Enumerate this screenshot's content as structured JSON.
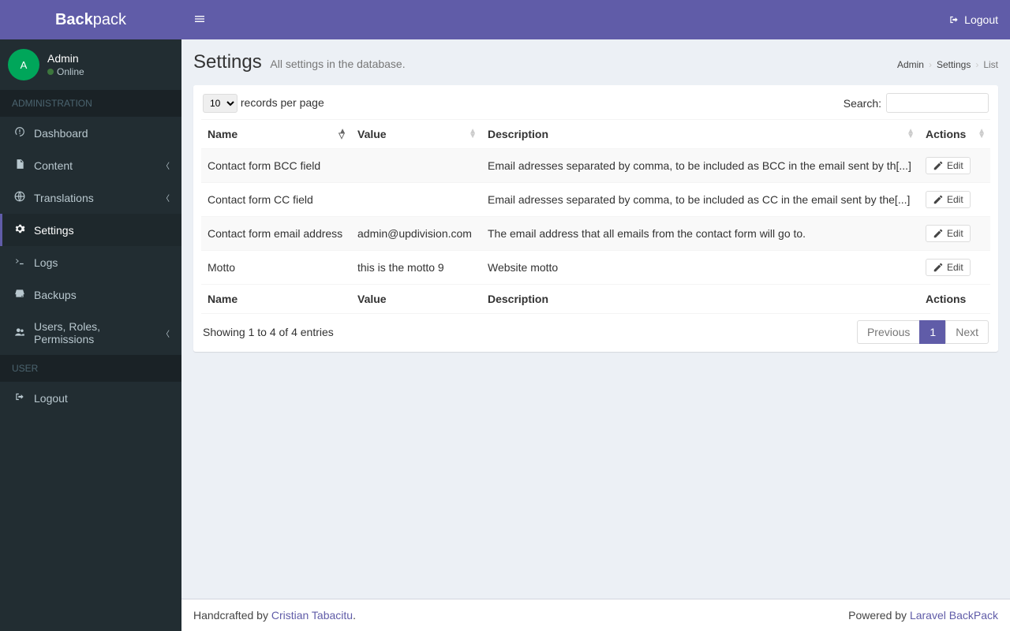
{
  "brand": {
    "bold": "Back",
    "light": "pack"
  },
  "user": {
    "name": "Admin",
    "status": "Online",
    "avatar_initial": "A"
  },
  "topbar": {
    "logout": "Logout"
  },
  "nav": {
    "section_admin": "ADMINISTRATION",
    "section_user": "USER",
    "items": [
      {
        "label": "Dashboard"
      },
      {
        "label": "Content"
      },
      {
        "label": "Translations"
      },
      {
        "label": "Settings"
      },
      {
        "label": "Logs"
      },
      {
        "label": "Backups"
      },
      {
        "label": "Users, Roles, Permissions"
      },
      {
        "label": "Logout"
      }
    ]
  },
  "header": {
    "title": "Settings",
    "subtitle": "All settings in the database."
  },
  "breadcrumb": {
    "a": "Admin",
    "b": "Settings",
    "c": "List"
  },
  "table": {
    "per_page_value": "10",
    "per_page_label": "records per page",
    "search_label": "Search:",
    "cols": {
      "name": "Name",
      "value": "Value",
      "description": "Description",
      "actions": "Actions"
    },
    "rows": [
      {
        "name": "Contact form BCC field",
        "value": "",
        "description": "Email adresses separated by comma, to be included as BCC in the email sent by th[...]"
      },
      {
        "name": "Contact form CC field",
        "value": "",
        "description": "Email adresses separated by comma, to be included as CC in the email sent by the[...]"
      },
      {
        "name": "Contact form email address",
        "value": "admin@updivision.com",
        "description": "The email address that all emails from the contact form will go to."
      },
      {
        "name": "Motto",
        "value": "this is the motto 9",
        "description": "Website motto"
      }
    ],
    "edit_label": "Edit",
    "info": "Showing 1 to 4 of 4 entries",
    "pagination": {
      "prev": "Previous",
      "page": "1",
      "next": "Next"
    }
  },
  "footer": {
    "left_prefix": "Handcrafted by ",
    "left_link": "Cristian Tabacitu",
    "left_suffix": ".",
    "right_prefix": "Powered by ",
    "right_link": "Laravel BackPack"
  }
}
